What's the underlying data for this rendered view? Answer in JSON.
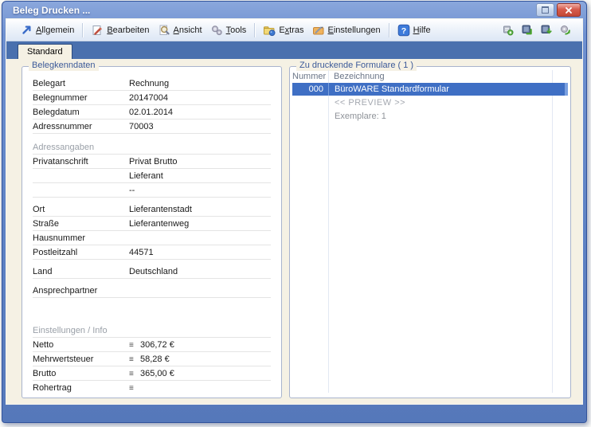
{
  "window": {
    "title": "Beleg Drucken ...",
    "controls": {
      "restore": "restore-window",
      "close": "close-window"
    }
  },
  "toolbar": {
    "menus": [
      {
        "label": "Allgemein",
        "mnemonic": 0,
        "icon": "arrow-up-right-icon"
      },
      {
        "type": "separator"
      },
      {
        "label": "Bearbeiten",
        "mnemonic": 0,
        "icon": "edit-page-icon"
      },
      {
        "label": "Ansicht",
        "mnemonic": 0,
        "icon": "magnifier-icon"
      },
      {
        "label": "Tools",
        "mnemonic": 0,
        "icon": "gears-icon"
      },
      {
        "type": "separator"
      },
      {
        "label": "Extras",
        "mnemonic": 1,
        "icon": "folder-ball-icon"
      },
      {
        "label": "Einstellungen",
        "mnemonic": 0,
        "icon": "notes-pencil-icon"
      },
      {
        "type": "separator"
      },
      {
        "label": "Hilfe",
        "mnemonic": 0,
        "icon": "help-icon"
      }
    ],
    "right_icons": [
      "printer-icon",
      "export-icon",
      "import-icon",
      "refresh-icon"
    ]
  },
  "tabs": [
    {
      "label": "Standard",
      "active": true
    }
  ],
  "left_panel": {
    "title": "Belegkenndaten",
    "rows": [
      {
        "type": "field",
        "label": "Belegart",
        "value": "Rechnung"
      },
      {
        "type": "field",
        "label": "Belegnummer",
        "value": "20147004"
      },
      {
        "type": "field",
        "label": "Belegdatum",
        "value": "02.01.2014"
      },
      {
        "type": "field",
        "label": "Adressnummer",
        "value": "70003"
      },
      {
        "type": "spacer",
        "h": 8
      },
      {
        "type": "section",
        "label": "Adressangaben"
      },
      {
        "type": "field",
        "label": "Privatanschrift",
        "value": "Privat Brutto"
      },
      {
        "type": "field",
        "label": "",
        "value": "Lieferant"
      },
      {
        "type": "field",
        "label": "",
        "value": "--"
      },
      {
        "type": "spacer",
        "h": 6
      },
      {
        "type": "field",
        "label": "Ort",
        "value": "Lieferantenstadt"
      },
      {
        "type": "field",
        "label": "Straße",
        "value": "Lieferantenweg"
      },
      {
        "type": "field",
        "label": "Hausnummer",
        "value": ""
      },
      {
        "type": "field",
        "label": "Postleitzahl",
        "value": "44571"
      },
      {
        "type": "spacer",
        "h": 6
      },
      {
        "type": "field",
        "label": "Land",
        "value": "Deutschland"
      },
      {
        "type": "spacer",
        "h": 6
      },
      {
        "type": "field",
        "label": "Ansprechpartner",
        "value": ""
      },
      {
        "type": "spacer",
        "h": 32
      },
      {
        "type": "section",
        "label": "Einstellungen / Info"
      },
      {
        "type": "money",
        "label": "Netto",
        "icon": "sum-icon",
        "value": "306,72 €"
      },
      {
        "type": "money",
        "label": "Mehrwertsteuer",
        "icon": "sum-icon",
        "value": "58,28 €"
      },
      {
        "type": "money",
        "label": "Brutto",
        "icon": "sum-icon",
        "value": "365,00 €"
      },
      {
        "type": "money",
        "label": "Rohertrag",
        "icon": "sum-icon",
        "value": ""
      }
    ]
  },
  "right_panel": {
    "title": "Zu druckende Formulare ( 1 )",
    "columns": [
      "Nummer",
      "Bezeichnung"
    ],
    "rows": [
      {
        "nummer": "000",
        "bezeichnung": "BüroWARE Standardformular",
        "selected": true
      }
    ],
    "preview_label": "<< PREVIEW >>",
    "copies_label": "Exemplare: 1"
  },
  "colors": {
    "titlebar": "#5a7fc2",
    "window_frame": "#5e82c4",
    "tab_strip": "#4a70ae",
    "selection": "#3f6fc4",
    "content_bg": "#f5f1e4",
    "legend_text": "#3c5a99"
  }
}
